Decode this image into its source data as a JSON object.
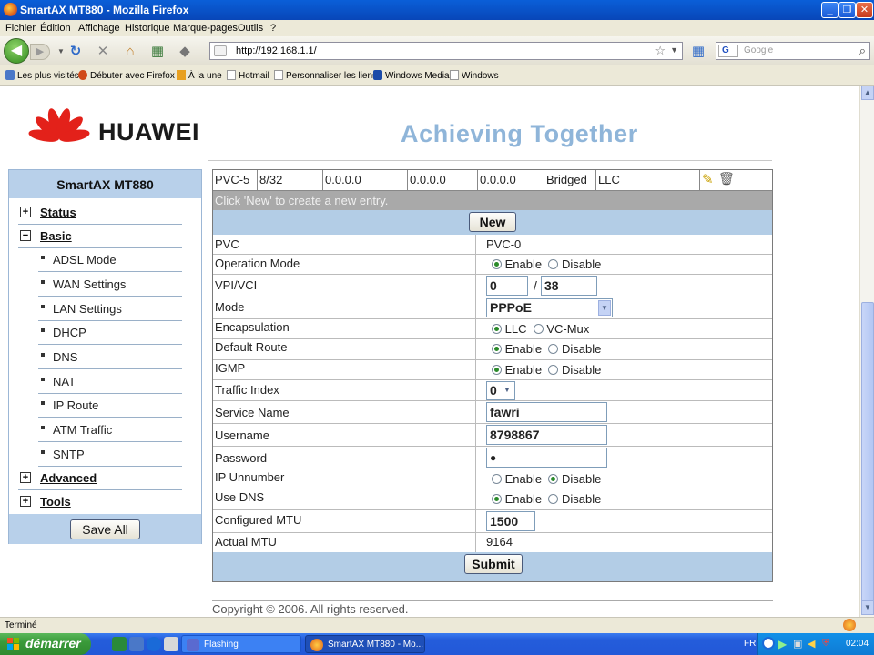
{
  "window": {
    "title": "SmartAX MT880 - Mozilla Firefox"
  },
  "menu": [
    "Fichier",
    "Édition",
    "Affichage",
    "Historique",
    "Marque-pages",
    "Outils",
    "?"
  ],
  "nav": {
    "url": "http://192.168.1.1/",
    "search_placeholder": "Google",
    "search_engine_letter": "G"
  },
  "bookmarks": [
    "Les plus visités",
    "Débuter avec Firefox",
    "À la une",
    "Hotmail",
    "Personnaliser les liens",
    "Windows Media",
    "Windows"
  ],
  "header": {
    "brand": "HUAWEI",
    "tagline": "Achieving Together"
  },
  "sidebar": {
    "title": "SmartAX MT880",
    "items": [
      {
        "label": "Status",
        "expander": "+"
      },
      {
        "label": "Basic",
        "expander": "−"
      },
      {
        "label": "Advanced",
        "expander": "+"
      },
      {
        "label": "Tools",
        "expander": "+"
      }
    ],
    "subitems": [
      "ADSL Mode",
      "WAN Settings",
      "LAN Settings",
      "DHCP",
      "DNS",
      "NAT",
      "IP Route",
      "ATM Traffic",
      "SNTP"
    ],
    "save_all": "Save All"
  },
  "pvc_table": {
    "row": [
      "PVC-5",
      "8/32",
      "0.0.0.0",
      "0.0.0.0",
      "0.0.0.0",
      "Bridged",
      "LLC"
    ],
    "hint": "Click 'New' to create a new entry.",
    "new_button": "New"
  },
  "form": {
    "pvc": {
      "label": "PVC",
      "value": "PVC-0"
    },
    "operation_mode": {
      "label": "Operation Mode",
      "options": [
        "Enable",
        "Disable"
      ],
      "selected": "Enable"
    },
    "vpi_vci": {
      "label": "VPI/VCI",
      "vpi": "0",
      "separator": "/",
      "vci": "38"
    },
    "mode": {
      "label": "Mode",
      "value": "PPPoE"
    },
    "encapsulation": {
      "label": "Encapsulation",
      "options": [
        "LLC",
        "VC-Mux"
      ],
      "selected": "LLC"
    },
    "default_route": {
      "label": "Default Route",
      "options": [
        "Enable",
        "Disable"
      ],
      "selected": "Enable"
    },
    "igmp": {
      "label": "IGMP",
      "options": [
        "Enable",
        "Disable"
      ],
      "selected": "Enable"
    },
    "traffic_index": {
      "label": "Traffic Index",
      "value": "0"
    },
    "service_name": {
      "label": "Service Name",
      "value": "fawri"
    },
    "username": {
      "label": "Username",
      "value": "8798867"
    },
    "password": {
      "label": "Password",
      "value": "●"
    },
    "ip_unnumber": {
      "label": "IP Unnumber",
      "options": [
        "Enable",
        "Disable"
      ],
      "selected": "Disable"
    },
    "use_dns": {
      "label": "Use DNS",
      "options": [
        "Enable",
        "Disable"
      ],
      "selected": "Enable"
    },
    "configured_mtu": {
      "label": "Configured MTU",
      "value": "1500"
    },
    "actual_mtu": {
      "label": "Actual MTU",
      "value": "9164"
    },
    "submit": "Submit"
  },
  "copyright": "Copyright © 2006. All rights reserved.",
  "status": "Terminé",
  "taskbar": {
    "start": "démarrer",
    "tasks": [
      "Flashing",
      "SmartAX MT880 - Mo..."
    ],
    "lang": "FR",
    "clock": "02:04"
  },
  "colors": {
    "huawei_red": "#e3211a",
    "sidebar_blue": "#b8d0ea",
    "tagline": "#8fb5d9",
    "xp_taskbar": "#245ddb"
  }
}
